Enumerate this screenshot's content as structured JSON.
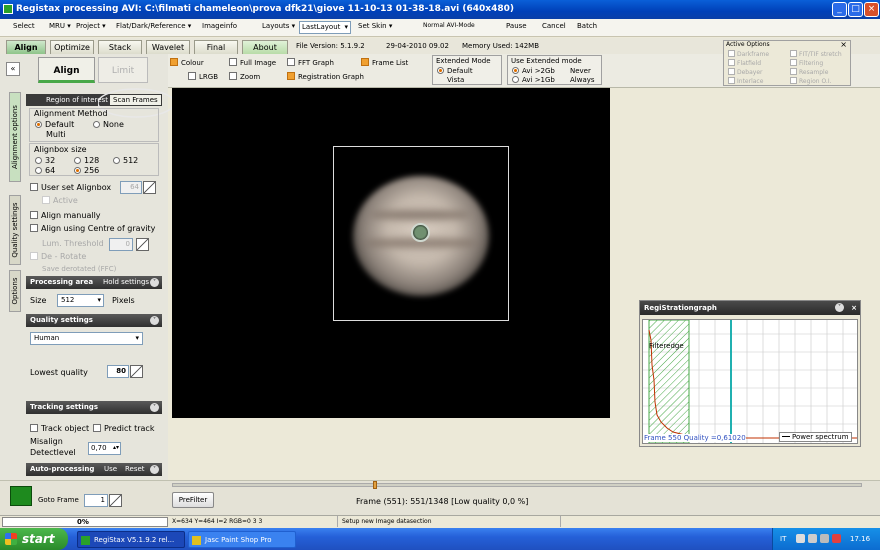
{
  "window": {
    "title": "Registax processing AVI: C:\\filmati chameleon\\prova dfk21\\giove 11-10-13 01-38-18.avi (640x480)"
  },
  "menu": {
    "items": [
      "Select",
      "MRU ▾",
      "Project ▾",
      "Flat/Dark/Reference ▾",
      "Imageinfo",
      "Layouts ▾",
      "Set Skin ▾",
      "Normal AVI-Mode",
      "Pause",
      "Cancel",
      "Batch"
    ],
    "layout_value": "LastLayout"
  },
  "tabs": [
    "Align",
    "Optimize",
    "Stack",
    "Wavelet",
    "Final",
    "About"
  ],
  "info": {
    "version": "File Version: 5.1.9.2",
    "date": "29-04-2010 09.02",
    "memory": "Memory Used: 142MB"
  },
  "options": {
    "colour": "Colour",
    "full_image": "Full Image",
    "fft_graph": "FFT Graph",
    "frame_list": "Frame List",
    "lrgb": "LRGB",
    "zoom": "Zoom",
    "registration_graph": "Registration Graph",
    "extended_mode_title": "Extended Mode",
    "ext_default": "Default",
    "ext_vista": "Vista",
    "use_extended_title": "Use  Extended mode",
    "avi_gt2": "Avi >2Gb",
    "avi_gt1": "Avi >1Gb",
    "never": "Never",
    "always": "Always"
  },
  "active_options": {
    "title": "Active Options",
    "items": [
      "Darkframe",
      "FIT/TIF stretch",
      "Flatfield",
      "Filtering",
      "Debayer",
      "Resample",
      "Interlace",
      "Region O.I."
    ]
  },
  "panel": {
    "align_tab": "Align",
    "limit_tab": "Limit",
    "collapse": "«",
    "vtabs": [
      "Alignment options",
      "Quality settings",
      "Options"
    ],
    "roi_tab": "Region of interest",
    "scan_frames": "Scan Frames",
    "method_title": "Alignment Method",
    "method_default": "Default",
    "method_none": "None",
    "method_multi": "Multi",
    "alignbox_title": "Alignbox size",
    "sizes": [
      "32",
      "128",
      "512",
      "64",
      "256"
    ],
    "user_alignbox": "User set Alignbox",
    "user_alignbox_value": "64",
    "active": "Active",
    "align_manually": "Align manually",
    "align_cog": "Align using Centre of gravity",
    "lum_threshold": "Lum. Threshold",
    "lum_threshold_value": "0",
    "derotate": "De - Rotate",
    "save_derotated": "Save derotated (FFC)",
    "processing_area": "Processing area",
    "hold_settings": "Hold settings",
    "size_label": "Size",
    "size_value": "512",
    "pixels": "Pixels",
    "quality_settings": "Quality settings",
    "quality_method": "Human",
    "lowest_quality": "Lowest quality",
    "lowest_quality_value": "80",
    "tracking_settings": "Tracking settings",
    "track_object": "Track object",
    "predict_track": "Predict track",
    "misalign": "Misalign",
    "detectlevel": "Detectlevel",
    "misalign_value": "0,70",
    "auto_processing": "Auto-processing",
    "use": "Use",
    "reset": "Reset"
  },
  "graph": {
    "title": "RegiStrationgraph",
    "filteredge": "Filteredge",
    "frame_quality": "Frame 550 Quality =0,61020",
    "legend": "Power spectrum"
  },
  "bottom": {
    "goto_frame": "Goto Frame",
    "goto_value": "1",
    "prefilter": "PreFilter",
    "frame_status": "Frame (551): 551/1348 [Low quality 0,0 %]"
  },
  "status": {
    "progress_text": "0%",
    "progress": 0.0,
    "coords": "X=634 Y=464 I=2 RGB=0 3 3",
    "message": "Setup new Image datasection"
  },
  "taskbar": {
    "start": "start",
    "tasks": [
      "RegiStax V5.1.9.2 rel...",
      "Jasc Paint Shop Pro"
    ],
    "lang": "IT",
    "time": "17.16"
  },
  "colors": {
    "accent_green": "#48a848",
    "title_blue": "#0a5fd8",
    "graph_line": "#c03000",
    "graph_marker": "#20b0b0"
  }
}
